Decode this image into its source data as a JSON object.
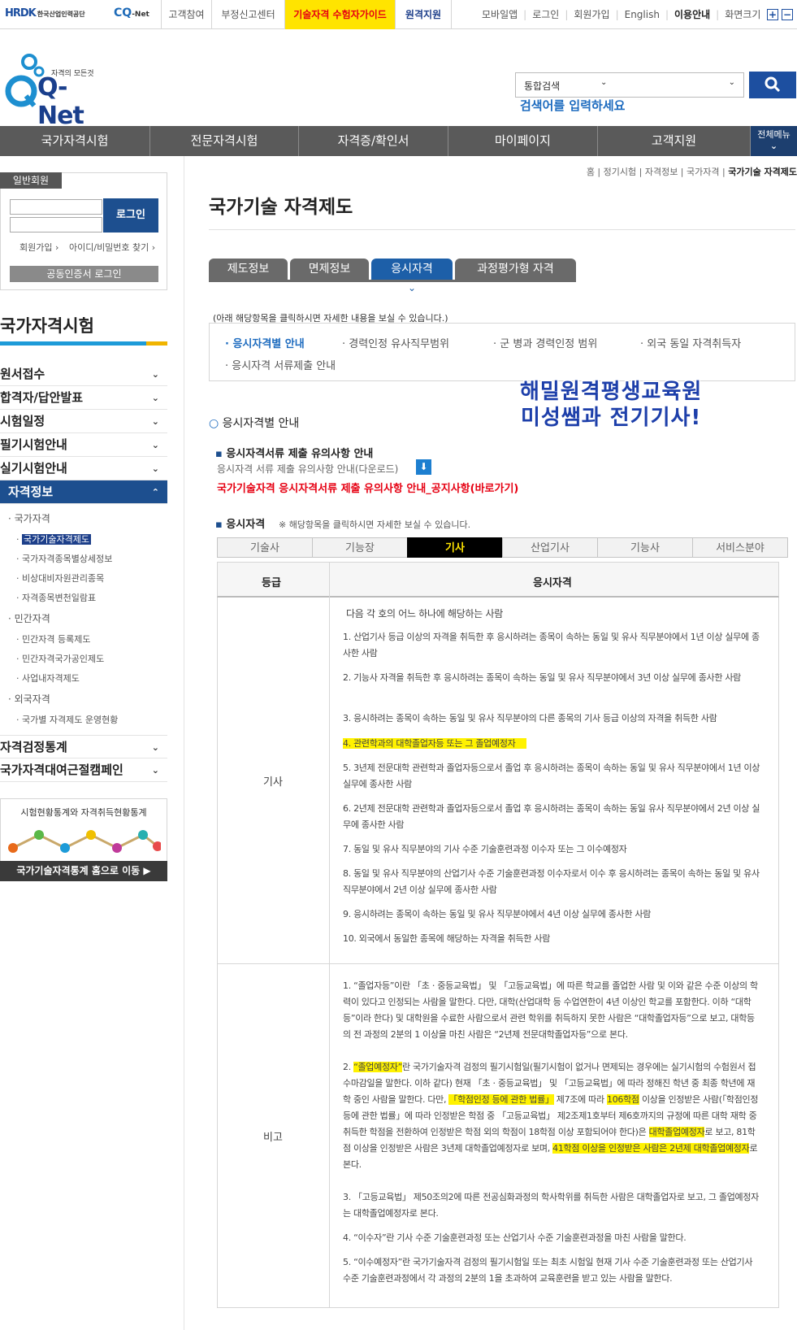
{
  "topbar": {
    "hrdk_logo": "HRDK",
    "hrdk_sub": "한국산업인력공단",
    "cqnet_logo": "CQ",
    "cqnet_sub": "-Net",
    "links": [
      "고객참여",
      "부정신고센터",
      "기술자격 수험자가이드",
      "원격지원"
    ],
    "right_links": [
      "모바일앱",
      "로그인",
      "회원가입",
      "English",
      "이용안내",
      "화면크기"
    ],
    "zoom_in": "+",
    "zoom_out": "−"
  },
  "header": {
    "logo_text": "Q-Net",
    "slogan": "자격의 모든것",
    "search_category": "통합검색",
    "search_placeholder": "검색어를 입력하세요"
  },
  "gnb": {
    "items": [
      "국가자격시험",
      "전문자격시험",
      "자격증/확인서",
      "마이페이지",
      "고객지원"
    ],
    "all_menu": "전체메뉴"
  },
  "login": {
    "tab": "일반회원",
    "button": "로그인",
    "signup": "회원가입",
    "find": "아이디/비밀번호 찾기",
    "cert": "공동인증서 로그인"
  },
  "sidebar": {
    "title": "국가자격시험",
    "menus": [
      "원서접수",
      "합격자/답안발표",
      "시험일정",
      "필기시험안내",
      "실기시험안내",
      "자격정보"
    ],
    "sub": {
      "group1": "국가자격",
      "group1_items": [
        "국가기술자격제도",
        "국가자격종목별상세정보",
        "비상대비자원관리종목",
        "자격종목변천일람표"
      ],
      "group2": "민간자격",
      "group2_items": [
        "민간자격 등록제도",
        "민간자격국가공인제도",
        "사업내자격제도"
      ],
      "group3": "외국자격",
      "group3_items": [
        "국가별 자격제도 운영현황"
      ]
    },
    "menus2": [
      "자격검정통계",
      "국가자격대여근절캠페인"
    ],
    "stat_title": "시험현황통계와 자격취득현황통계",
    "stat_button": "국가기술자격통계 홈으로 이동"
  },
  "breadcrumb": [
    "홈",
    "정기시험",
    "자격정보",
    "국가자격",
    "국가기술 자격제도"
  ],
  "page_title": "국가기술 자격제도",
  "main_tabs": [
    "제도정보",
    "면제정보",
    "응시자격",
    "과정평가형 자격"
  ],
  "info_note": "(아래 해당항목을 클릭하시면 자세한 내용을 보실 수 있습니다.)",
  "info_links": [
    "응시자격별 안내",
    "경력인정 유사직무범위",
    "군 병과 경력인정 범위",
    "외국 동일 자격취득자",
    "응시자격 서류제출 안내"
  ],
  "banner": [
    "해밀원격평생교육원",
    "미성쌤과 전기기사!"
  ],
  "section_title": "응시자격별 안내",
  "doc_head": "응시자격서류 제출 유의사항 안내",
  "doc_download": "응시자격 서류 제출 유의사항 안내(다운로드)",
  "doc_red_link": "국가기술자격 응시자격서류 제출 유의사항 안내_공지사항(바로가기)",
  "qual_head": "응시자격",
  "qual_note": "※ 해당항목을 클릭하시면 자세한 보실 수 있습니다.",
  "grade_tabs": [
    "기술사",
    "기능장",
    "기사",
    "산업기사",
    "기능사",
    "서비스분야"
  ],
  "table": {
    "col1": "등급",
    "col2": "응시자격",
    "row1_grade": "기사",
    "row1_intro": "다음 각 호의 어느 하나에 해당하는 사람",
    "row1_items": [
      "1. 산업기사 등급 이상의 자격을 취득한 후 응시하려는 종목이 속하는 동일 및 유사 직무분야에서 1년 이상 실무에 종사한 사람",
      "2. 기능사 자격을 취득한 후 응시하려는 종목이 속하는 동일 및 유사 직무분야에서 3년 이상 실무에 종사한 사람",
      "3. 응시하려는 종목이 속하는 동일 및 유사 직무분야의 다른 종목의 기사 등급 이상의 자격을 취득한 사람",
      "4. 관련학과의 대학졸업자등 또는 그 졸업예정자",
      "5. 3년제 전문대학 관련학과 졸업자등으로서 졸업 후 응시하려는 종목이 속하는 동일 및 유사 직무분야에서 1년 이상 실무에 종사한 사람",
      "6. 2년제 전문대학 관련학과 졸업자등으로서 졸업 후 응시하려는 종목이 속하는 동일 유사 직무분야에서 2년 이상 실무에 종사한 사람",
      "7. 동일 및 유사 직무분야의 기사 수준 기술훈련과정 이수자 또는 그 이수예정자",
      "8. 동일 및 유사 직무분야의 산업기사 수준 기술훈련과정 이수자로서 이수 후 응시하려는 종목이 속하는 동일 및 유사 직무분야에서 2년 이상 실무에 종사한 사람",
      "9. 응시하려는 종목이 속하는 동일 및 유사 직무분야에서 4년 이상 실무에 종사한 사람",
      "10. 외국에서 동일한 종목에 해당하는 자격을 취득한 사람"
    ],
    "row2_grade": "비고",
    "row2_item1": "1. “졸업자등”이란 「초ㆍ중등교육법」 및 「고등교육법」에 따른 학교를 졸업한 사람 및 이와 같은 수준 이상의 학력이 있다고 인정되는 사람을 말한다. 다만, 대학(산업대학 등 수업연한이 4년 이상인 학교를 포함한다. 이하 “대학등”이라 한다) 및 대학원을 수료한 사람으로서 관련 학위를 취득하지 못한 사람은 “대학졸업자등”으로 보고, 대학등의 전 과정의 2분의 1 이상을 마친 사람은 “2년제 전문대학졸업자등”으로 본다.",
    "row2_item2_a": "2. ",
    "row2_item2_hl1": "“졸업예정자”",
    "row2_item2_b": "란 국가기술자격 검정의 필기시험일(필기시험이 없거나 면제되는 경우에는 실기시험의 수험원서 접수마감일을 말한다. 이하 같다) 현재 「초ㆍ중등교육법」 및 「고등교육법」에 따라 정해진 학년 중 최종 학년에 재학 중인 사람을 말한다. 다만, ",
    "row2_item2_hl2": "「학점인정 등에 관한 법률」",
    "row2_item2_c": " 제7조에 따라 ",
    "row2_item2_hl3": "106학점",
    "row2_item2_d": " 이상을 인정받은 사람(「학점인정 등에 관한 법률」에 따라 인정받은 학점 중 「고등교육법」 제2조제1호부터 제6호까지의 규정에 따른 대학 재학 중 취득한 학점을 전환하여 인정받은 학점 외의 학점이 18학점 이상 포함되어야 한다)은 ",
    "row2_item2_hl4": "대학졸업예정자",
    "row2_item2_e": "로 보고, 81학점 이상을 인정받은 사람은 3년제 대학졸업예정자로 보며, ",
    "row2_item2_hl5": "41학점 이상을 인정받은 사람은 2년제 대학졸업예정자",
    "row2_item2_f": "로 본다.",
    "row2_item3": "3. 「고등교육법」 제50조의2에 따른 전공심화과정의 학사학위를 취득한 사람은 대학졸업자로 보고, 그 졸업예정자는 대학졸업예정자로 본다.",
    "row2_item4": "4. “이수자”란 기사 수준 기술훈련과정 또는 산업기사 수준 기술훈련과정을 마친 사람을 말한다.",
    "row2_item5": "5. “이수예정자”란 국가기술자격 검정의 필기시험일 또는 최초 시험일 현재 기사 수준 기술훈련과정 또는 산업기사 수준 기술훈련과정에서 각 과정의 2분의 1을 초과하여 교육훈련을 받고 있는 사람을 말한다."
  }
}
